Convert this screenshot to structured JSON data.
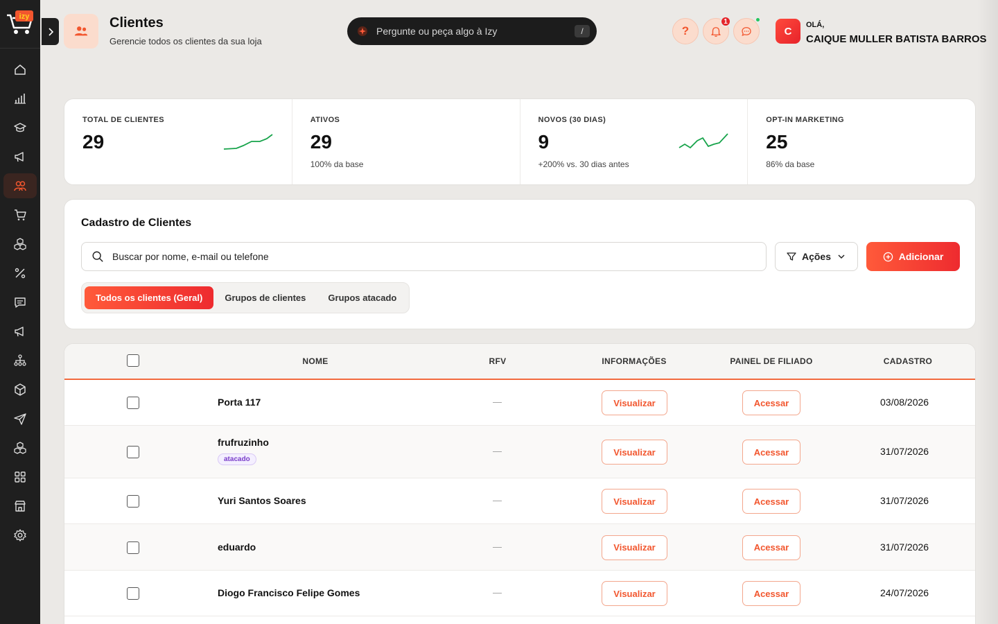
{
  "header": {
    "title": "Clientes",
    "subtitle": "Gerencie todos os clientes da sua loja",
    "ask_placeholder": "Pergunte ou peça algo à Izy",
    "ask_shortcut": "/",
    "notification_count": "1",
    "greeting": "OLÁ,",
    "user_name": "CAIQUE MULLER BATISTA BARROS",
    "avatar_initial": "C"
  },
  "sidebar": {
    "items": [
      {
        "icon": "home-icon"
      },
      {
        "icon": "bar-chart-icon"
      },
      {
        "icon": "graduation-cap-icon"
      },
      {
        "icon": "megaphone-icon"
      },
      {
        "icon": "users-icon",
        "active": true
      },
      {
        "icon": "cart-icon"
      },
      {
        "icon": "boxes-icon"
      },
      {
        "icon": "percent-icon"
      },
      {
        "icon": "message-icon"
      },
      {
        "icon": "megaphone-icon"
      },
      {
        "icon": "network-icon"
      },
      {
        "icon": "package-icon"
      },
      {
        "icon": "send-icon"
      },
      {
        "icon": "boxes-icon"
      },
      {
        "icon": "grid-icon"
      },
      {
        "icon": "store-icon"
      },
      {
        "icon": "settings-icon"
      }
    ]
  },
  "stats": [
    {
      "label": "TOTAL DE CLIENTES",
      "value": "29",
      "sub": ""
    },
    {
      "label": "ATIVOS",
      "value": "29",
      "sub": "100% da base"
    },
    {
      "label": "NOVOS (30 DIAS)",
      "value": "9",
      "sub": "+200% vs. 30 dias antes"
    },
    {
      "label": "OPT-IN MARKETING",
      "value": "25",
      "sub": "86% da base"
    }
  ],
  "registry": {
    "title": "Cadastro de Clientes",
    "search_placeholder": "Buscar por nome, e-mail ou telefone",
    "actions_label": "Ações",
    "add_label": "Adicionar",
    "tabs": [
      {
        "label": "Todos os clientes (Geral)",
        "active": true
      },
      {
        "label": "Grupos de clientes"
      },
      {
        "label": "Grupos atacado"
      }
    ]
  },
  "table": {
    "headers": {
      "name": "NOME",
      "rfv": "RFV",
      "info": "INFORMAÇÕES",
      "affiliate": "PAINEL DE FILIADO",
      "date": "CADASTRO"
    },
    "view_label": "Visualizar",
    "access_label": "Acessar",
    "rows": [
      {
        "name": "Porta 117",
        "tag": "",
        "rfv": "—",
        "date": "03/08/2026"
      },
      {
        "name": "frufruzinho",
        "tag": "atacado",
        "rfv": "—",
        "date": "31/07/2026"
      },
      {
        "name": "Yuri Santos Soares",
        "tag": "",
        "rfv": "—",
        "date": "31/07/2026"
      },
      {
        "name": "eduardo",
        "tag": "",
        "rfv": "—",
        "date": "31/07/2026"
      },
      {
        "name": "Diogo Francisco Felipe Gomes",
        "tag": "",
        "rfv": "—",
        "date": "24/07/2026"
      }
    ]
  },
  "colors": {
    "accent": "#f2562e",
    "sidebar": "#1f1f1f",
    "spark": "#16a34a",
    "background": "#ebe9e6"
  }
}
